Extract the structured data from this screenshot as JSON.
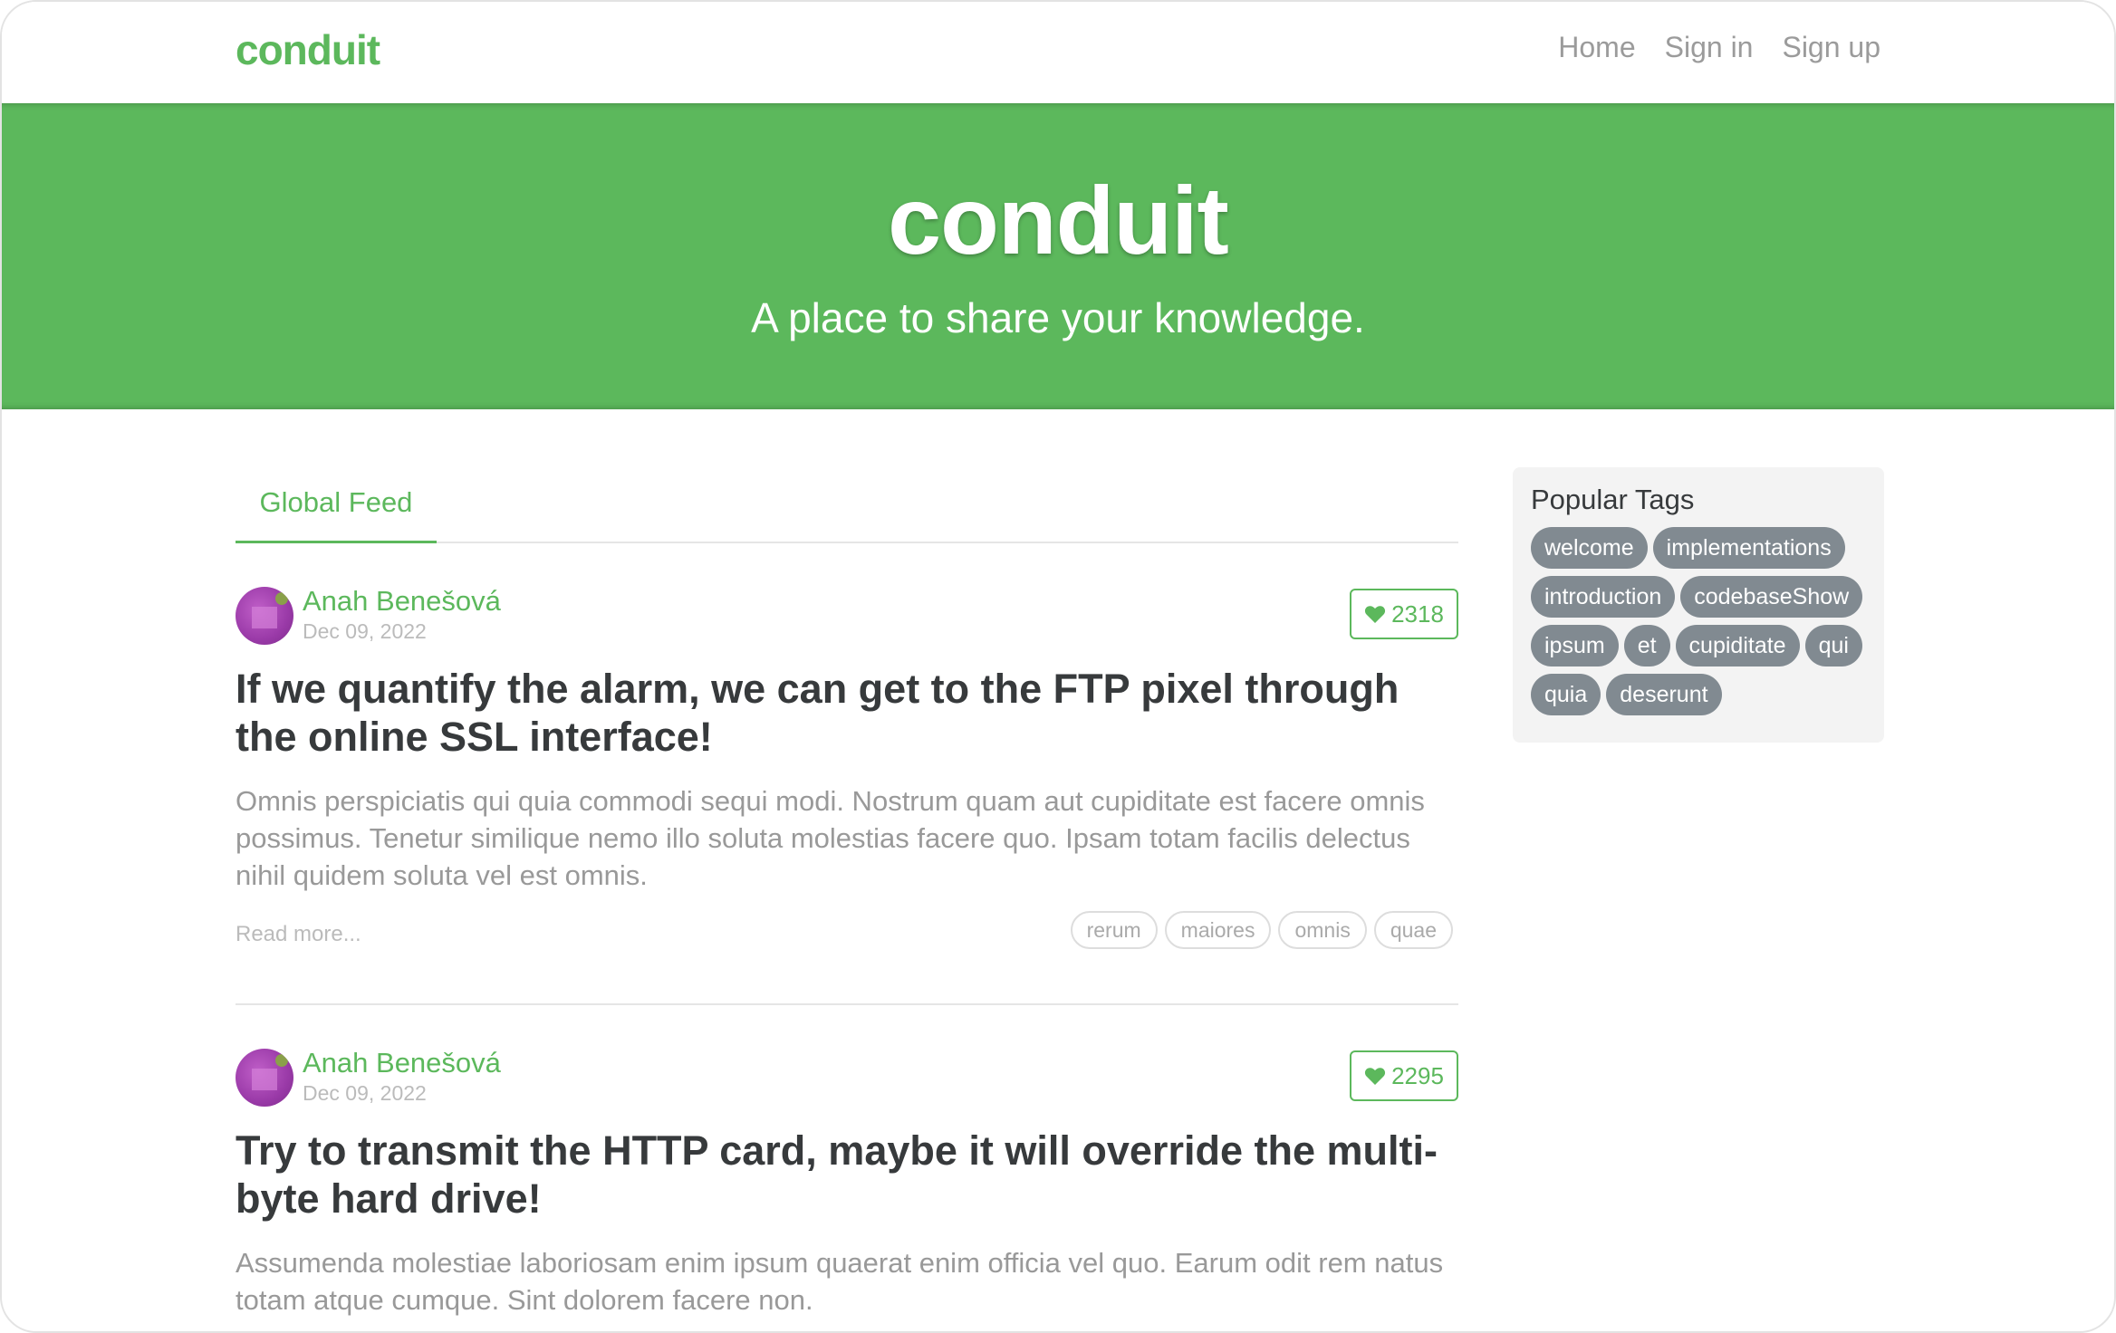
{
  "navbar": {
    "brand": "conduit",
    "links": [
      "Home",
      "Sign in",
      "Sign up"
    ]
  },
  "banner": {
    "title": "conduit",
    "subtitle": "A place to share your knowledge."
  },
  "feed": {
    "tab_label": "Global Feed",
    "articles": [
      {
        "author": "Anah Benešová",
        "date": "Dec 09, 2022",
        "likes": "2318",
        "title": "If we quantify the alarm, we can get to the FTP pixel through the online SSL interface!",
        "description": "Omnis perspiciatis qui quia commodi sequi modi. Nostrum quam aut cupiditate est facere omnis possimus. Tenetur similique nemo illo soluta molestias facere quo. Ipsam totam facilis delectus nihil quidem soluta vel est omnis.",
        "read_more": "Read more...",
        "tags": [
          "rerum",
          "maiores",
          "omnis",
          "quae"
        ]
      },
      {
        "author": "Anah Benešová",
        "date": "Dec 09, 2022",
        "likes": "2295",
        "title": "Try to transmit the HTTP card, maybe it will override the multi-byte hard drive!",
        "description": "Assumenda molestiae laboriosam enim ipsum quaerat enim officia vel quo. Earum odit rem natus totam atque cumque. Sint dolorem facere non."
      }
    ]
  },
  "sidebar": {
    "title": "Popular Tags",
    "tags": [
      "welcome",
      "implementations",
      "introduction",
      "codebaseShow",
      "ipsum",
      "et",
      "cupiditate",
      "qui",
      "quia",
      "deserunt"
    ]
  },
  "colors": {
    "brand": "#5cb85c",
    "tag_pill": "#818a91"
  }
}
